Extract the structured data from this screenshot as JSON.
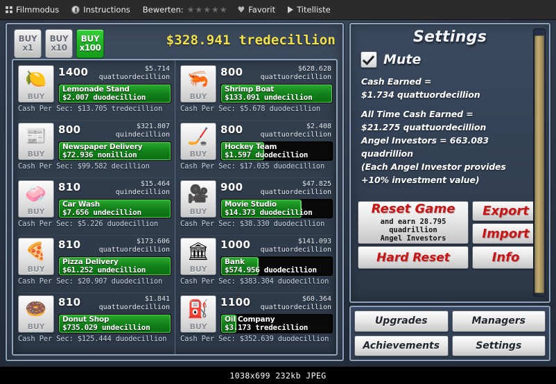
{
  "viewer": {
    "toolbar": {
      "filmmode_label": "Filmmodus",
      "instructions_label": "Instructions",
      "rate_label": "Bewerten:",
      "stars": "★★★★★",
      "favorite_label": "Favorit",
      "titlelist_label": "Titelliste"
    },
    "status": "1038x699  232kb  JPEG"
  },
  "game": {
    "buy_buttons": [
      {
        "line1": "BUY",
        "line2": "x1",
        "active": false
      },
      {
        "line1": "BUY",
        "line2": "x10",
        "active": false
      },
      {
        "line1": "BUY",
        "line2": "x100",
        "active": true
      }
    ],
    "cash_total": "$328.941 tredecillion",
    "businesses": [
      {
        "icon": "lemon-icon",
        "glyph": "🍋",
        "buy_label": "BUY",
        "count": "1400",
        "price_amount": "$5.714",
        "price_scale": "quattuordecillion",
        "name": "Lemonade Stand",
        "cost": "$2.007 duodecillion",
        "progress": 100,
        "cps": "Cash Per Sec: $13.705 tredecillion"
      },
      {
        "icon": "newspaper-icon",
        "glyph": "📰",
        "buy_label": "BUY",
        "count": "800",
        "price_amount": "$321.807",
        "price_scale": "quindecillion",
        "name": "Newspaper Delivery",
        "cost": "$72.936 nonillion",
        "progress": 100,
        "cps": "Cash Per Sec: $99.582 decillion"
      },
      {
        "icon": "car-wash-icon",
        "glyph": "🧼",
        "buy_label": "BUY",
        "count": "810",
        "price_amount": "$15.464",
        "price_scale": "quindecillion",
        "name": "Car Wash",
        "cost": "$7.656 undecillion",
        "progress": 100,
        "cps": "Cash Per Sec: $5.226 duodecillion"
      },
      {
        "icon": "pizza-icon",
        "glyph": "🍕",
        "buy_label": "BUY",
        "count": "810",
        "price_amount": "$173.606",
        "price_scale": "quattuordecillion",
        "name": "Pizza Delivery",
        "cost": "$61.252 undecillion",
        "progress": 100,
        "cps": "Cash Per Sec: $20.907 duodecillion"
      },
      {
        "icon": "donut-icon",
        "glyph": "🍩",
        "buy_label": "BUY",
        "count": "810",
        "price_amount": "$1.841",
        "price_scale": "quattuordecillion",
        "name": "Donut Shop",
        "cost": "$735.029 undecillion",
        "progress": 100,
        "cps": "Cash Per Sec: $125.444 duodecillion"
      },
      {
        "icon": "shrimp-icon",
        "glyph": "🦐",
        "buy_label": "BUY",
        "count": "800",
        "price_amount": "$628.628",
        "price_scale": "quattuordecillion",
        "name": "Shrimp Boat",
        "cost": "$133.091 undecillion",
        "progress": 100,
        "cps": "Cash Per Sec: $5.678 duodecillion"
      },
      {
        "icon": "hockey-icon",
        "glyph": "🏒",
        "buy_label": "BUY",
        "count": "800",
        "price_amount": "$2.408",
        "price_scale": "quattuordecillion",
        "name": "Hockey Team",
        "cost": "$1.597 duodecillion",
        "progress": 38,
        "cps": "Cash Per Sec: $17.035 duodecillion"
      },
      {
        "icon": "movie-camera-icon",
        "glyph": "🎥",
        "buy_label": "BUY",
        "count": "900",
        "price_amount": "$47.825",
        "price_scale": "quattuordecillion",
        "name": "Movie Studio",
        "cost": "$14.373 duodecillion",
        "progress": 72,
        "cps": "Cash Per Sec: $38.330 duodecillion"
      },
      {
        "icon": "bank-icon",
        "glyph": "🏛",
        "buy_label": "BUY",
        "count": "1000",
        "price_amount": "$141.093",
        "price_scale": "quattuordecillion",
        "name": "Bank",
        "cost": "$574.956 duodecillion",
        "progress": 33,
        "cps": "Cash Per Sec: $383.304 duodecillion"
      },
      {
        "icon": "oil-derrick-icon",
        "glyph": "⛽",
        "buy_label": "BUY",
        "count": "1100",
        "price_amount": "$60.364",
        "price_scale": "quattuordecillion",
        "name": "Oil Company",
        "cost": "$3.173 tredecillion",
        "progress": 13,
        "cps": "Cash Per Sec: $352.639 duodecillion"
      }
    ],
    "settings": {
      "title": "Settings",
      "mute_label": "Mute",
      "mute_checked": true,
      "stats": [
        "Cash Earned =",
        "$1.734 quattuordecillion",
        "All Time Cash Earned =",
        "$21.275 quattuordecillion",
        "Angel Investors = 663.083",
        "quadrillion",
        "(Each Angel Investor provides",
        "+10% investment value)"
      ],
      "reset_game_title": "Reset Game",
      "reset_game_sub_line1": "and earn 28.795",
      "reset_game_sub_line2": "quadrillion",
      "reset_game_sub_line3": "Angel Investors",
      "hard_reset_label": "Hard Reset",
      "export_label": "Export",
      "import_label": "Import",
      "info_label": "Info"
    },
    "nav": {
      "upgrades_label": "Upgrades",
      "managers_label": "Managers",
      "achievements_label": "Achievements",
      "settings_label": "Settings"
    },
    "colors": {
      "cash_yellow": "#f2e14a",
      "progress_green": "#1fae24",
      "buy_active_green": "#1fae24",
      "danger_red": "#cc1414",
      "panel_border": "#8fa3bb"
    }
  }
}
